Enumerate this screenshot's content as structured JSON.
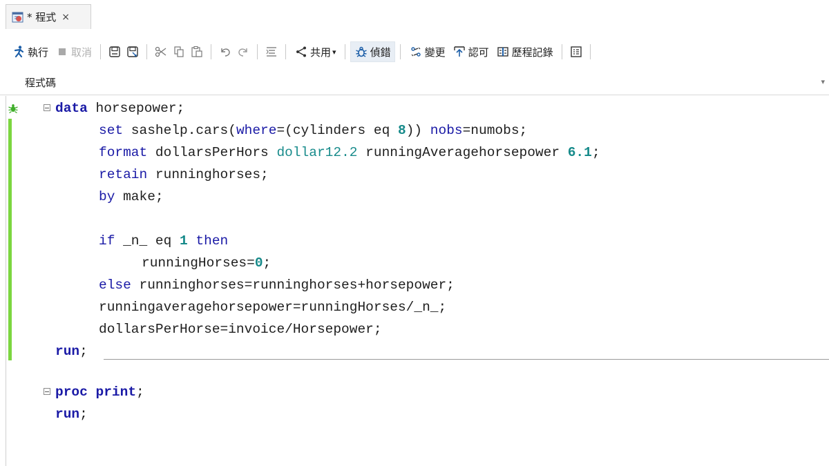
{
  "tab": {
    "icon": "sas-program-icon",
    "title": "* 程式",
    "close": "×"
  },
  "toolbar": {
    "run": "執行",
    "stop": "取消",
    "share": "共用",
    "share_caret": "▾",
    "debug": "偵錯",
    "changes": "變更",
    "commit": "認可",
    "history": "歷程記錄"
  },
  "pane": {
    "label": "程式碼",
    "collapse": "▾"
  },
  "code": {
    "l1": {
      "kw": "data",
      "rest": " horsepower;"
    },
    "l2": {
      "set": "set",
      "ds": " sashelp.cars(",
      "where": "where",
      "eq": "=(cylinders eq ",
      "n8": "8",
      "close": ")) ",
      "nobs": "nobs",
      "tail": "=numobs;"
    },
    "l3": {
      "kw": "format",
      "var": " dollarsPerHors ",
      "fmt1": "dollar12.2",
      "var2": " runningAveragehorsepower ",
      "fmt2": "6.1",
      "end": ";"
    },
    "l4": {
      "kw": "retain",
      "rest": " runninghorses;"
    },
    "l5": {
      "kw": "by",
      "rest": " make;"
    },
    "l6": {
      "kw": "if",
      "mid": " _n_ eq ",
      "num": "1",
      "then": " then"
    },
    "l7": {
      "rest": "runningHorses=",
      "num": "0",
      "end": ";"
    },
    "l8": {
      "kw": "else",
      "rest": " runninghorses=runninghorses+horsepower;"
    },
    "l9": {
      "rest": "runningaveragehorsepower=runningHorses/_n_;"
    },
    "l10": {
      "rest": "dollarsPerHorse=invoice/Horsepower;"
    },
    "l11": {
      "kw": "run",
      "end": ";"
    },
    "l12": {
      "kw": "proc",
      "kw2": " print",
      "end": ";"
    },
    "l13": {
      "kw": "run",
      "end": ";"
    }
  }
}
